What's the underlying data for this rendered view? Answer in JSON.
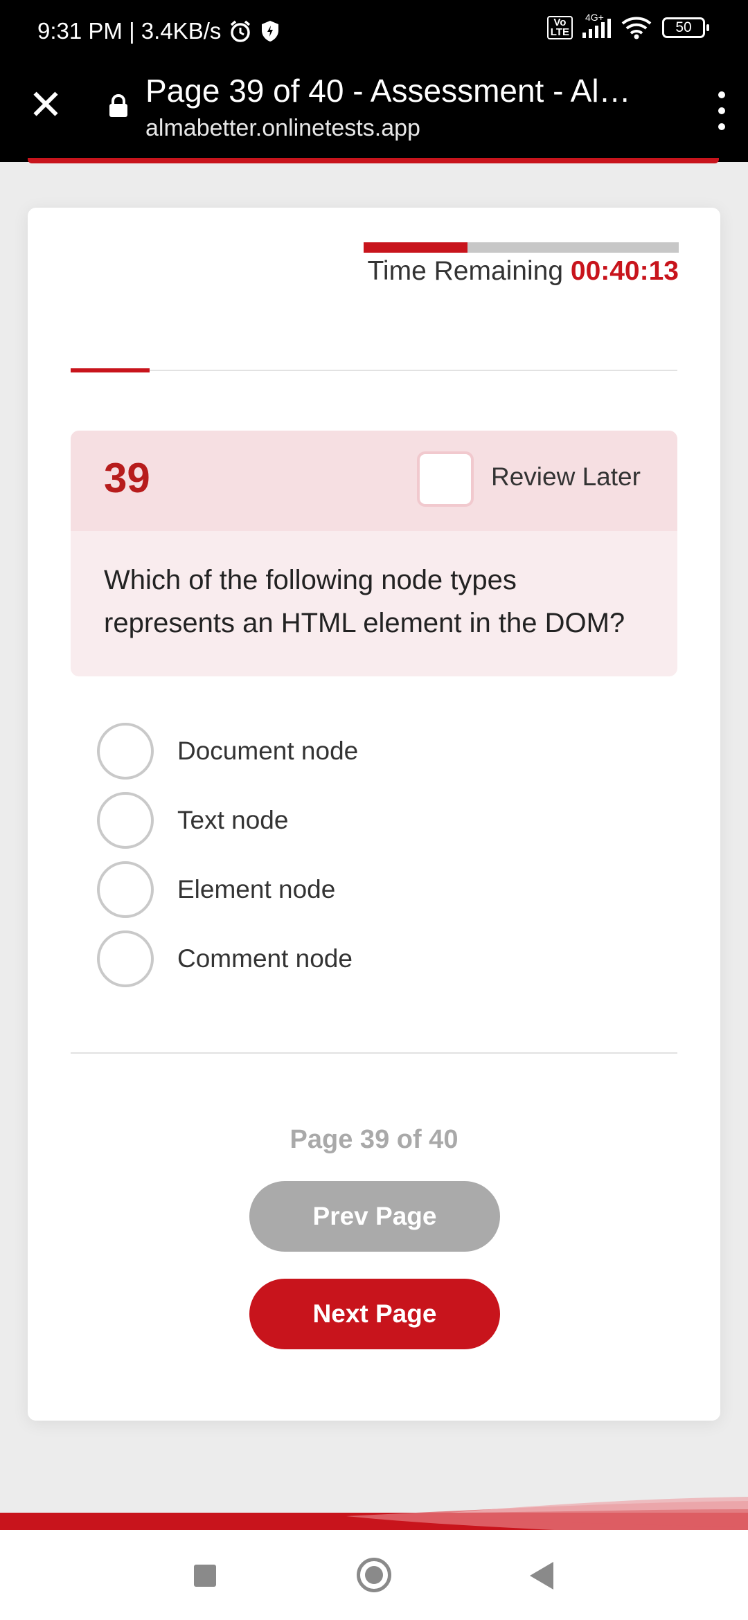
{
  "status_bar": {
    "time_speed": "9:31 PM | 3.4KB/s",
    "network_label": "4G+",
    "volte_label": "Vo\nLTE",
    "battery": "50",
    "icons": [
      "alarm-icon",
      "shield-icon",
      "signal-icon",
      "wifi-icon",
      "battery-icon"
    ]
  },
  "browser": {
    "title": "Page 39 of 40 - Assessment - Al…",
    "url": "almabetter.onlinetests.app",
    "icons": [
      "close-icon",
      "lock-icon",
      "more-vert-icon"
    ]
  },
  "timer": {
    "label": "Time Remaining",
    "value": "00:40:13",
    "progress_fraction": 0.33
  },
  "question": {
    "number": "39",
    "review_label": "Review Later",
    "review_checked": false,
    "text": "Which of the following node types represents an HTML element in the DOM?",
    "options": [
      {
        "label": "Document node",
        "selected": false
      },
      {
        "label": "Text node",
        "selected": false
      },
      {
        "label": "Element node",
        "selected": false
      },
      {
        "label": "Comment node",
        "selected": false
      }
    ]
  },
  "section_progress_fraction": 0.13,
  "pagination": {
    "indicator": "Page 39 of 40",
    "prev_label": "Prev Page",
    "next_label": "Next Page"
  },
  "colors": {
    "accent": "#c8141c",
    "question_header_bg": "#f6dfe2",
    "question_body_bg": "#f9ecee",
    "disabled_button": "#aaaaaa"
  },
  "nav_bar_icons": [
    "recents-icon",
    "home-icon",
    "back-icon"
  ]
}
